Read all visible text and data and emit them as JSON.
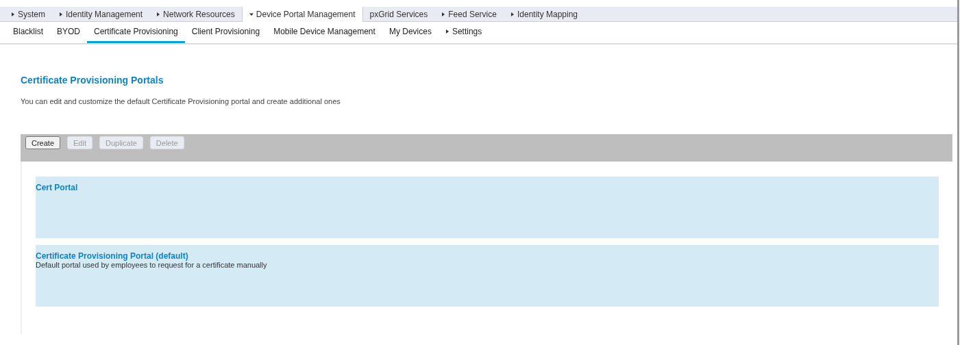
{
  "top_tabs": [
    {
      "label": "System",
      "kind": "menu",
      "selected": false
    },
    {
      "label": "Identity Management",
      "kind": "menu",
      "selected": false
    },
    {
      "label": "Network Resources",
      "kind": "menu",
      "selected": false
    },
    {
      "label": "Device Portal Management",
      "kind": "menu",
      "selected": true
    },
    {
      "label": "pxGrid Services",
      "kind": "plain",
      "selected": false
    },
    {
      "label": "Feed Service",
      "kind": "menu",
      "selected": false
    },
    {
      "label": "Identity Mapping",
      "kind": "menu",
      "selected": false
    }
  ],
  "sub_tabs": [
    {
      "label": "Blacklist",
      "kind": "plain",
      "selected": false
    },
    {
      "label": "BYOD",
      "kind": "plain",
      "selected": false
    },
    {
      "label": "Certificate Provisioning",
      "kind": "plain",
      "selected": true
    },
    {
      "label": "Client Provisioning",
      "kind": "plain",
      "selected": false
    },
    {
      "label": "Mobile Device Management",
      "kind": "plain",
      "selected": false
    },
    {
      "label": "My Devices",
      "kind": "plain",
      "selected": false
    },
    {
      "label": "Settings",
      "kind": "menu",
      "selected": false
    }
  ],
  "heading": "Certificate Provisioning Portals",
  "description": "You can edit and customize the default Certificate Provisioning portal and create additional ones",
  "toolbar": [
    {
      "label": "Create",
      "disabled": false
    },
    {
      "label": "Edit",
      "disabled": true
    },
    {
      "label": "Duplicate",
      "disabled": true
    },
    {
      "label": "Delete",
      "disabled": true
    }
  ],
  "portals": [
    {
      "title": "Cert Portal"
    },
    {
      "title": "Certificate Provisioning Portal (default)",
      "description": "Default portal used by employees to request for a certificate manually"
    }
  ]
}
